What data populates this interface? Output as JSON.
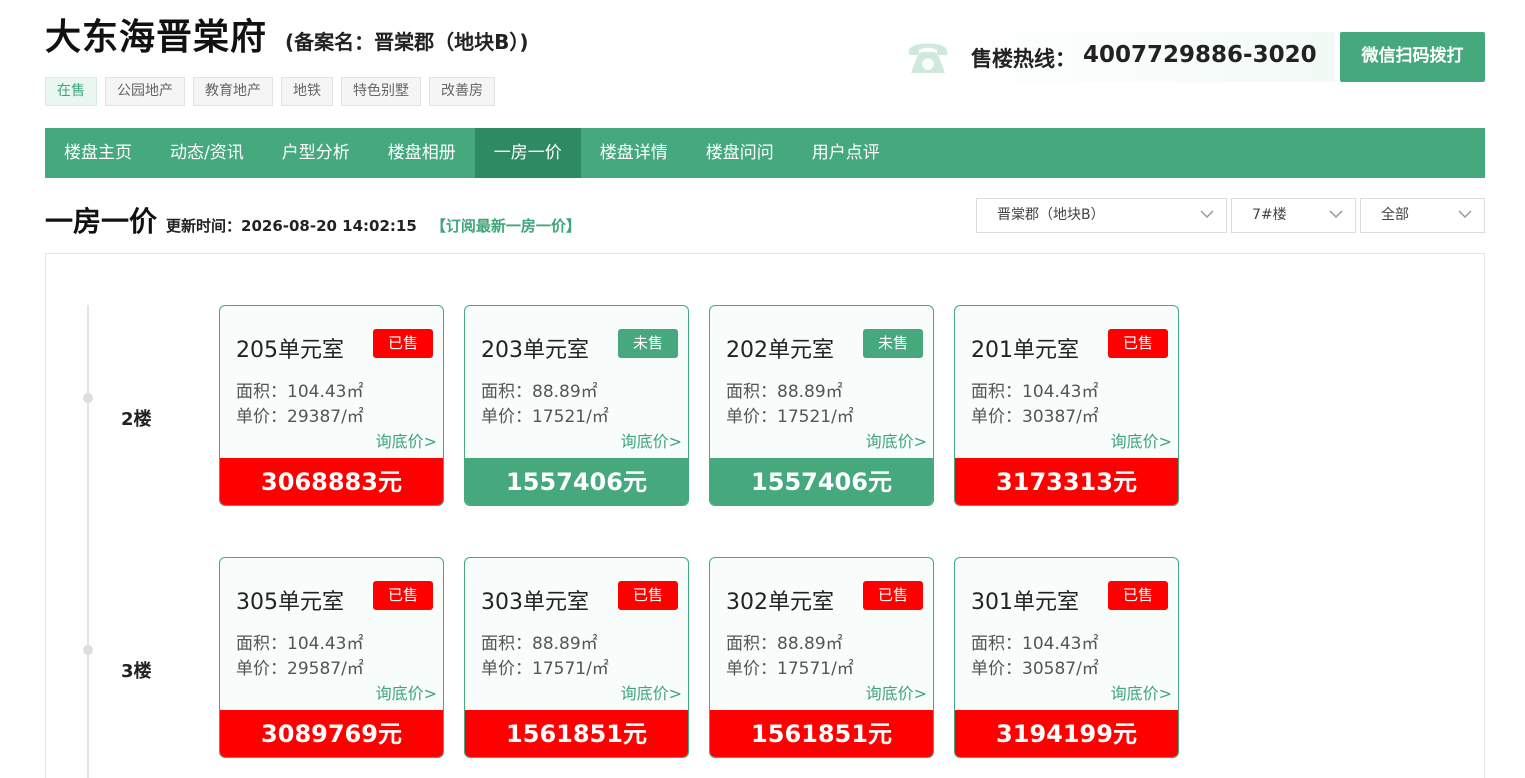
{
  "header": {
    "title": "大东海晋棠府",
    "record_name": "(备案名：晋棠郡（地块B）)",
    "tags": [
      "在售",
      "公园地产",
      "教育地产",
      "地铁",
      "特色别墅",
      "改善房"
    ]
  },
  "hotline": {
    "label": "售楼热线：",
    "number": "4007729886-3020",
    "wechat_button": "微信扫码拨打"
  },
  "nav": {
    "items": [
      "楼盘主页",
      "动态/资讯",
      "户型分析",
      "楼盘相册",
      "一房一价",
      "楼盘详情",
      "楼盘问问",
      "用户点评"
    ],
    "active": "一房一价"
  },
  "section": {
    "title": "一房一价",
    "update_time": "更新时间：2026-08-20 14:02:15",
    "subscribe": "【订阅最新一房一价】"
  },
  "filters": {
    "project": "晋棠郡（地块B）",
    "building": "7#楼",
    "status": "全部"
  },
  "colors": {
    "accent": "#45a97d",
    "sold": "#ff0000"
  },
  "floors": [
    {
      "label": "2楼",
      "units": [
        {
          "room": "205单元室",
          "status": "已售",
          "area": "面积：104.43㎡",
          "unit_price": "单价：29387/㎡",
          "ask": "询底价>",
          "total": "3068883元",
          "sold": true
        },
        {
          "room": "203单元室",
          "status": "未售",
          "area": "面积：88.89㎡",
          "unit_price": "单价：17521/㎡",
          "ask": "询底价>",
          "total": "1557406元",
          "sold": false
        },
        {
          "room": "202单元室",
          "status": "未售",
          "area": "面积：88.89㎡",
          "unit_price": "单价：17521/㎡",
          "ask": "询底价>",
          "total": "1557406元",
          "sold": false
        },
        {
          "room": "201单元室",
          "status": "已售",
          "area": "面积：104.43㎡",
          "unit_price": "单价：30387/㎡",
          "ask": "询底价>",
          "total": "3173313元",
          "sold": true
        }
      ]
    },
    {
      "label": "3楼",
      "units": [
        {
          "room": "305单元室",
          "status": "已售",
          "area": "面积：104.43㎡",
          "unit_price": "单价：29587/㎡",
          "ask": "询底价>",
          "total": "3089769元",
          "sold": true
        },
        {
          "room": "303单元室",
          "status": "已售",
          "area": "面积：88.89㎡",
          "unit_price": "单价：17571/㎡",
          "ask": "询底价>",
          "total": "1561851元",
          "sold": true
        },
        {
          "room": "302单元室",
          "status": "已售",
          "area": "面积：88.89㎡",
          "unit_price": "单价：17571/㎡",
          "ask": "询底价>",
          "total": "1561851元",
          "sold": true
        },
        {
          "room": "301单元室",
          "status": "已售",
          "area": "面积：104.43㎡",
          "unit_price": "单价：30587/㎡",
          "ask": "询底价>",
          "total": "3194199元",
          "sold": true
        }
      ]
    }
  ]
}
